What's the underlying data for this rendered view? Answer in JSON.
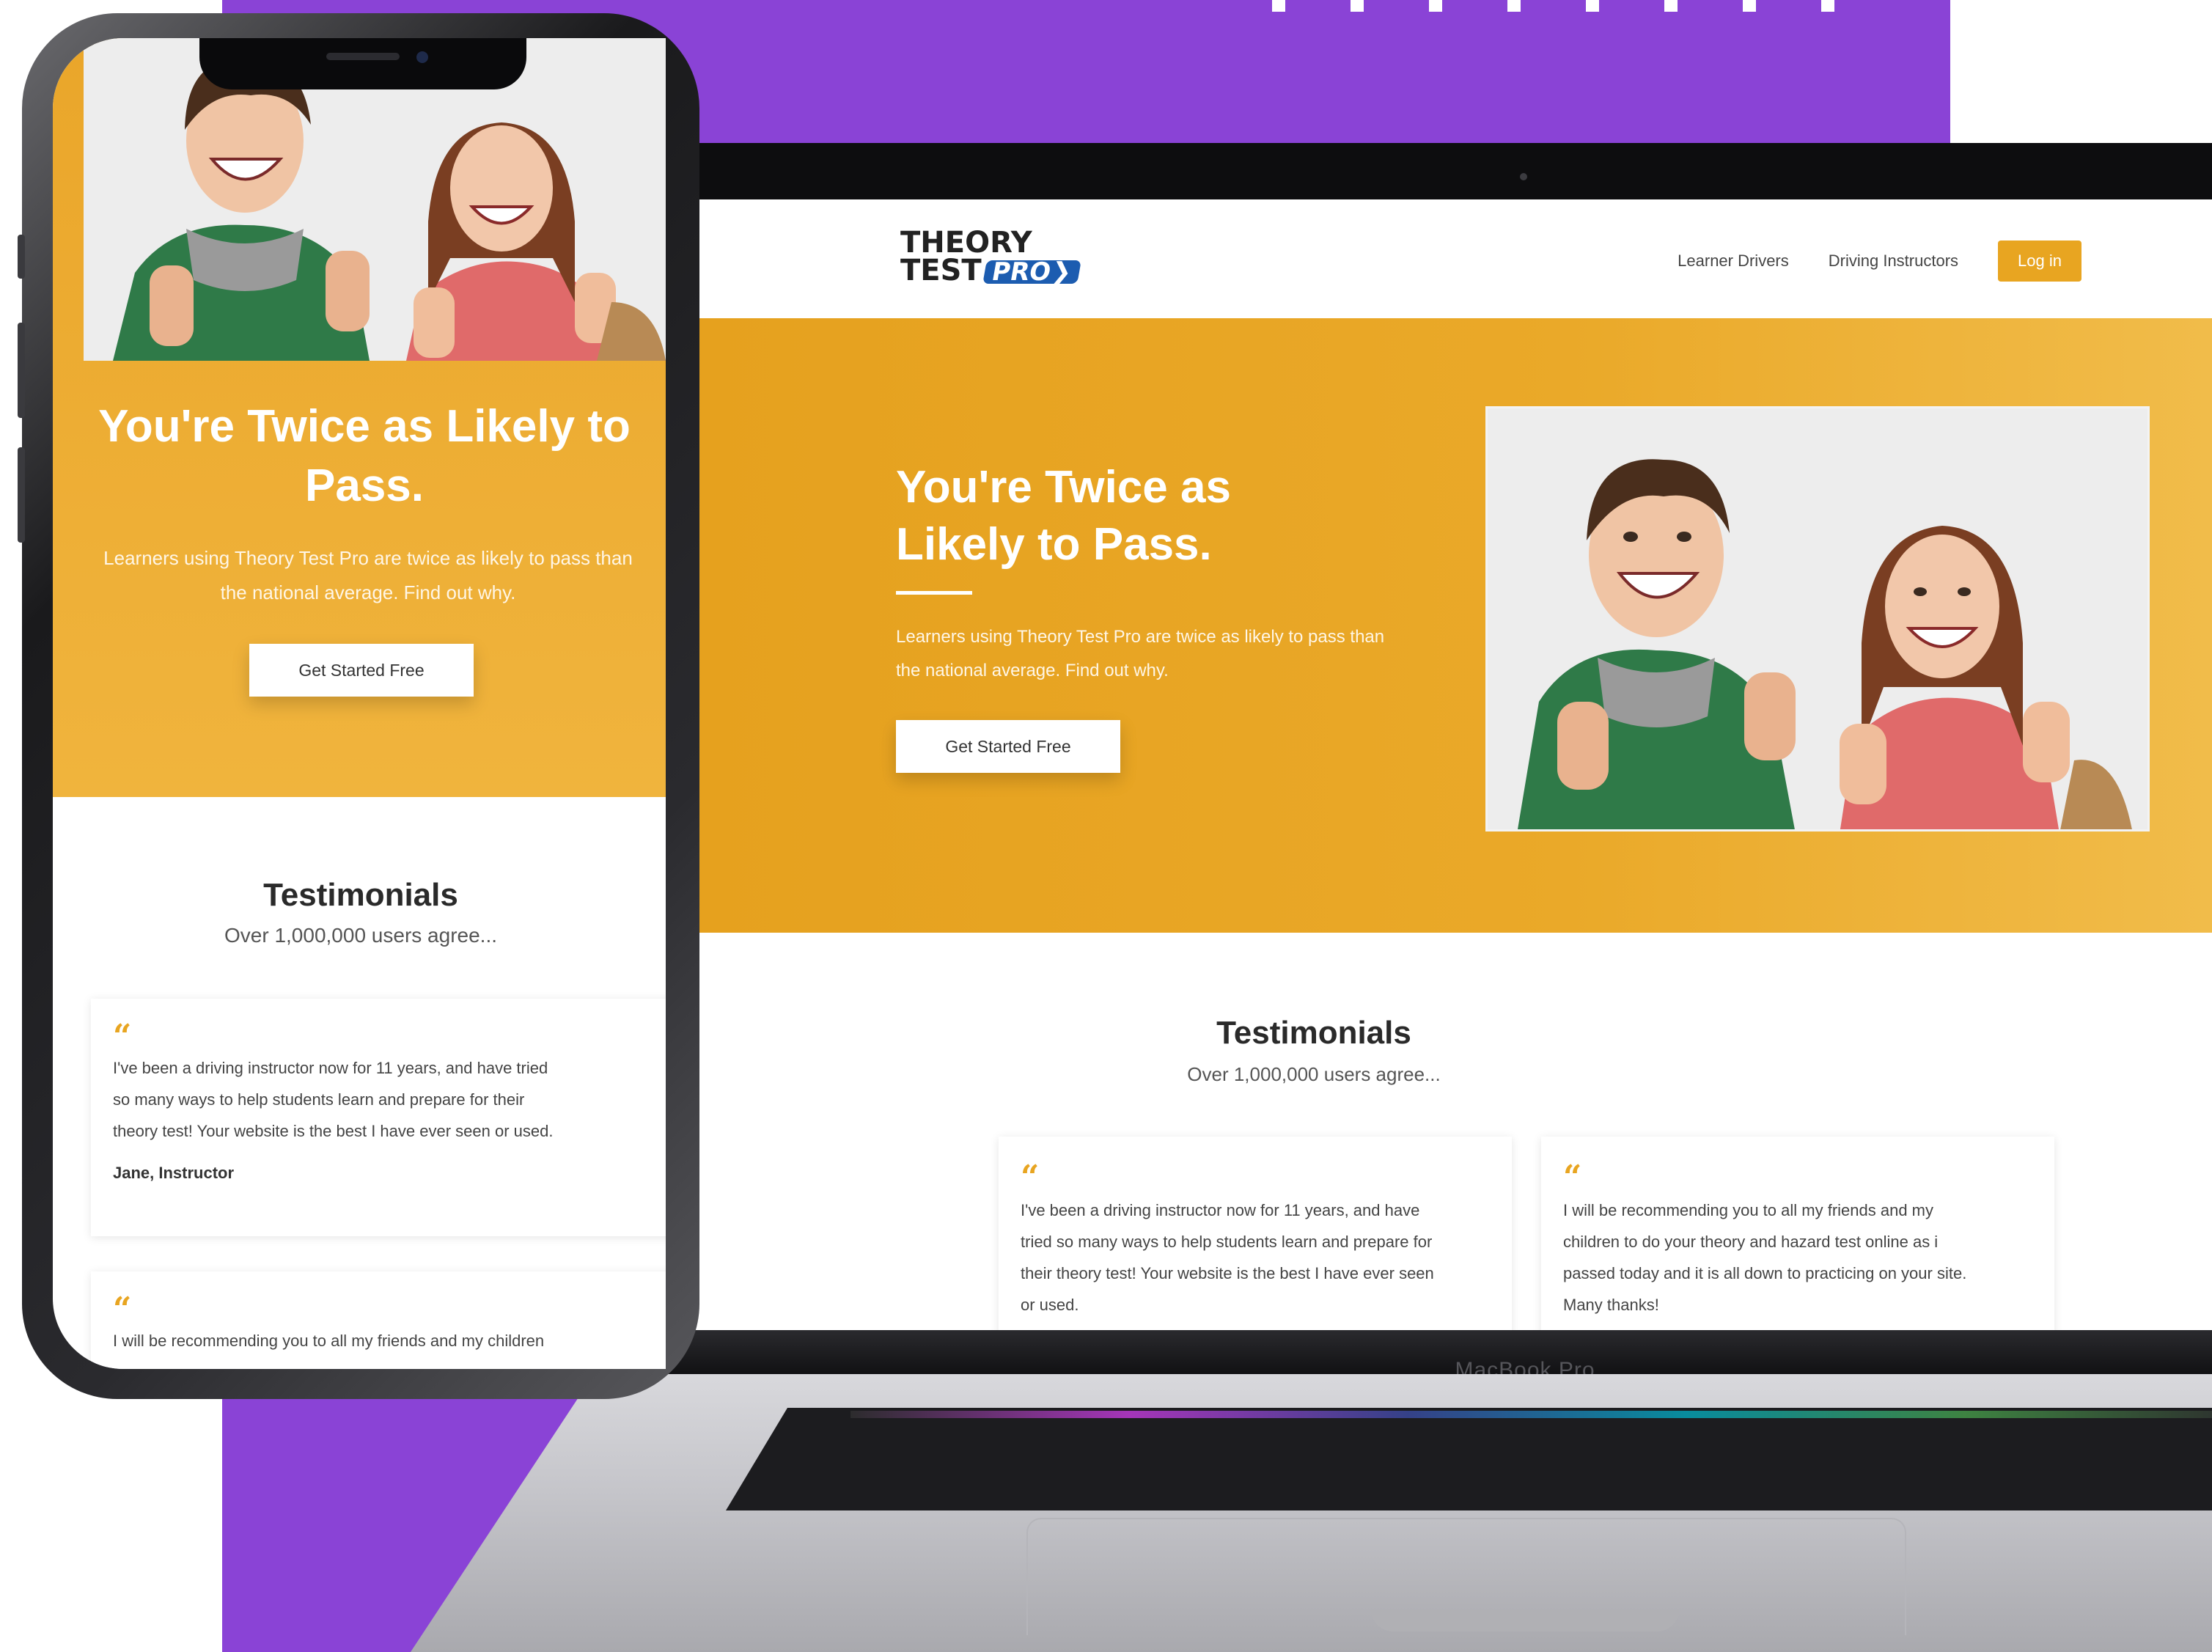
{
  "site": {
    "logo_line1": "THEORY",
    "logo_line2": "TEST",
    "logo_pro": "PRO",
    "nav": {
      "learner_drivers": "Learner Drivers",
      "driving_instructors": "Driving Instructors",
      "login": "Log in"
    },
    "hero": {
      "title_laptop": "You're Twice as Likely to Pass.",
      "title_phone": "You're Twice as Likely to Pass.",
      "subtitle_laptop": "Learners using Theory Test Pro are twice as likely to pass than the national average. Find out why.",
      "subtitle_phone": "Learners using Theory Test Pro are twice as likely to pass than the national average. Find out why.",
      "cta": "Get Started Free"
    },
    "testimonials": {
      "title": "Testimonials",
      "subtitle": "Over 1,000,000 users agree...",
      "quote_mark": "“",
      "items": [
        {
          "text": "I've been a driving instructor now for 11 years, and have tried so many ways to help students learn and prepare for their theory test! Your website is the best I have ever seen or used.",
          "lines": [
            "I've been a driving instructor now for 11 years, and have",
            "tried so many ways to help students learn and prepare for",
            "their theory test! Your website is the best I have ever seen",
            "or used."
          ],
          "phone_lines": [
            "I've been a driving instructor now for 11 years, and have tried",
            "so many ways to help students learn and prepare for their",
            "theory test! Your website is the best I have ever seen or used."
          ],
          "author": "Jane, Instructor"
        },
        {
          "text": "I will be recommending you to all my friends and my children to do your theory and hazard test online as i passed today and it is all down to practicing on your site. Many thanks!",
          "lines": [
            "I will be recommending you to all my friends and my",
            "children to do your theory and hazard test online as i",
            "passed today and it is all down to practicing on your site.",
            "Many thanks!"
          ],
          "phone_lines": [
            "I will be recommending you to all my friends and my children"
          ]
        }
      ]
    }
  },
  "device": {
    "laptop_label": "MacBook Pro"
  },
  "colors": {
    "background_purple": "#8a43d6",
    "brand_amber": "#e8a521",
    "logo_pro_blue": "#1c5cb0"
  },
  "icons": {
    "quote": "quote-icon"
  }
}
